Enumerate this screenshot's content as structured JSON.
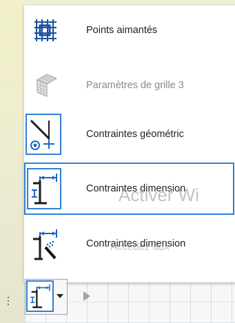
{
  "menu": {
    "items": [
      {
        "label": "Points aimantés",
        "icon": "snap-grid-icon"
      },
      {
        "label": "Paramètres de grille 3",
        "icon": "grid-3d-settings-icon"
      },
      {
        "label": "Contraintes géométric",
        "icon": "geometric-constraints-icon"
      },
      {
        "label": "Contraintes dimension",
        "icon": "dimension-constraints-icon"
      },
      {
        "label": "Contraintes dimension",
        "icon": "dimension-constraints-auto-icon"
      }
    ]
  },
  "watermark": {
    "line1": "Activer Wi",
    "line2": "Accédez aux"
  },
  "toolbar": {
    "icon": "dimension-constraints-icon",
    "dropdown_icon": "chevron-down-icon",
    "play_icon": "play-icon"
  },
  "colors": {
    "accent": "#2f7fd7",
    "icon_dark": "#1a1a1a",
    "icon_blue": "#1b67c2"
  }
}
